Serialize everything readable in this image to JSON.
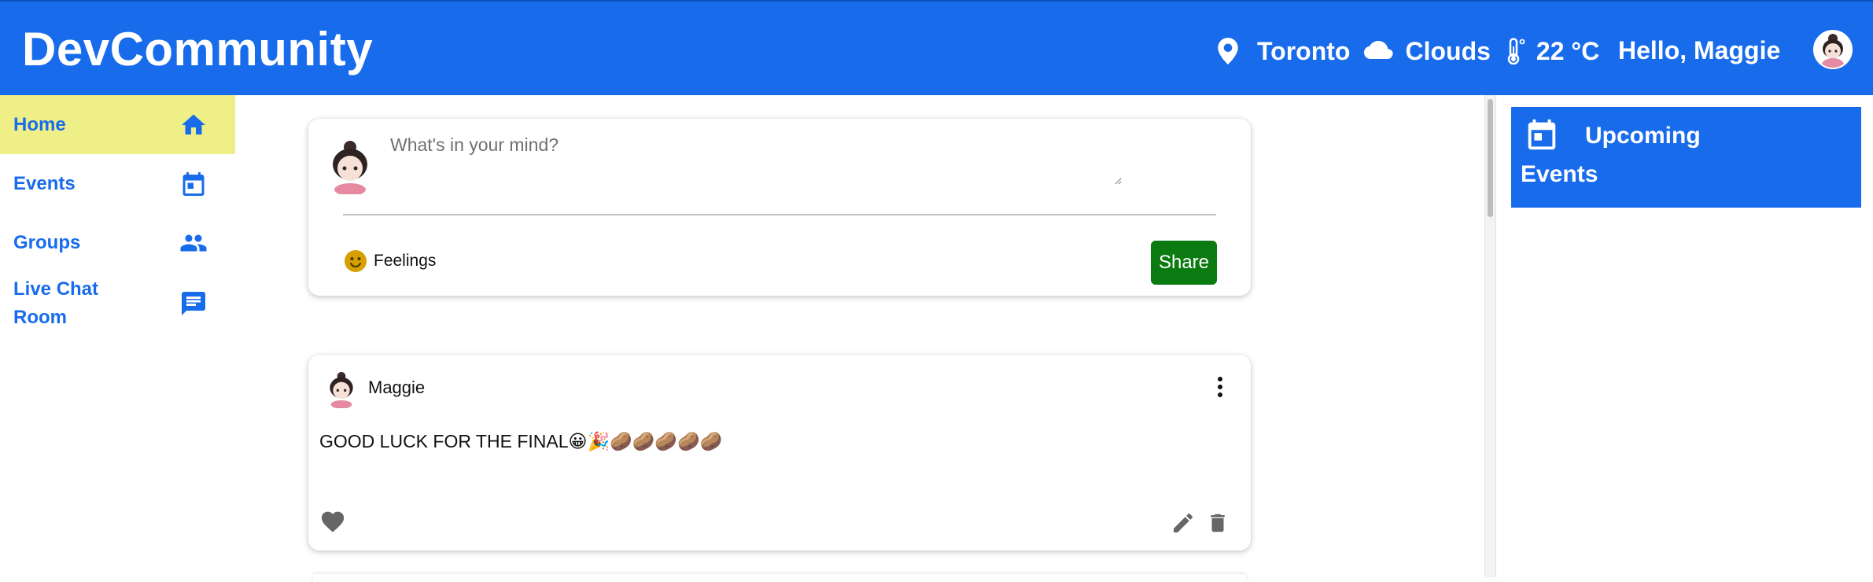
{
  "header": {
    "brand": "DevCommunity",
    "location": "Toronto",
    "weather": "Clouds",
    "temperature": "22 °C",
    "greeting": "Hello, Maggie"
  },
  "nav": {
    "items": [
      {
        "label": "Home",
        "icon": "home-icon",
        "active": true
      },
      {
        "label": "Events",
        "icon": "calendar-icon",
        "active": false
      },
      {
        "label": "Groups",
        "icon": "people-icon",
        "active": false
      },
      {
        "label": "Live Chat Room",
        "icon": "chat-icon",
        "active": false
      }
    ]
  },
  "composer": {
    "placeholder": "What's in your mind?",
    "feelings_label": "Feelings",
    "share_label": "Share"
  },
  "post": {
    "author": "Maggie",
    "text": "GOOD LUCK FOR THE FINAL😀🎉🥔🥔🥔🥔🥔"
  },
  "right_panel": {
    "title_line1": "Upcoming",
    "title_line2": "Events"
  },
  "colors": {
    "primary": "#186ceb",
    "active_nav": "#eef087",
    "share_button": "#0b7a10",
    "icon_gray": "#666666"
  }
}
